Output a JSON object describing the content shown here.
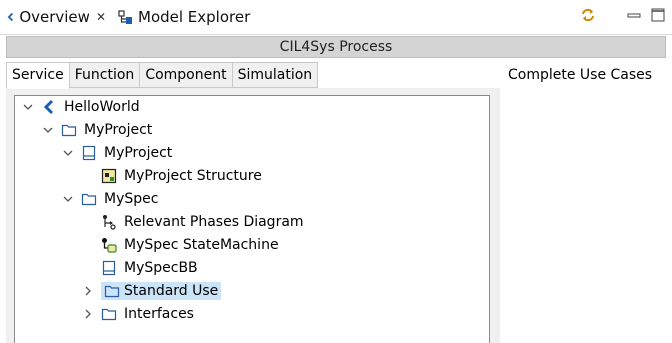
{
  "view_tabs": {
    "overview_label": "Overview",
    "model_explorer_label": "Model Explorer"
  },
  "process_title": "CIL4Sys Process",
  "tabs": [
    "Service",
    "Function",
    "Component",
    "Simulation"
  ],
  "right_panel": {
    "label": "Complete Use Cases"
  },
  "tree": [
    {
      "label": "HelloWorld",
      "icon": "project-root-icon",
      "expanded": true
    },
    {
      "label": "MyProject",
      "icon": "folder-icon",
      "expanded": true
    },
    {
      "label": "MyProject",
      "icon": "package-icon",
      "expanded": true
    },
    {
      "label": "MyProject Structure",
      "icon": "structure-diagram-icon"
    },
    {
      "label": "MySpec",
      "icon": "folder-icon",
      "expanded": true
    },
    {
      "label": "Relevant Phases Diagram",
      "icon": "phases-diagram-icon"
    },
    {
      "label": "MySpec StateMachine",
      "icon": "state-machine-icon"
    },
    {
      "label": "MySpecBB",
      "icon": "package-icon"
    },
    {
      "label": "Standard Use",
      "icon": "folder-icon",
      "expanded": false,
      "selected": true
    },
    {
      "label": "Interfaces",
      "icon": "folder-icon",
      "expanded": false
    }
  ],
  "colors": {
    "selection": "#cce4f7",
    "accent": "#1a5fb4"
  }
}
